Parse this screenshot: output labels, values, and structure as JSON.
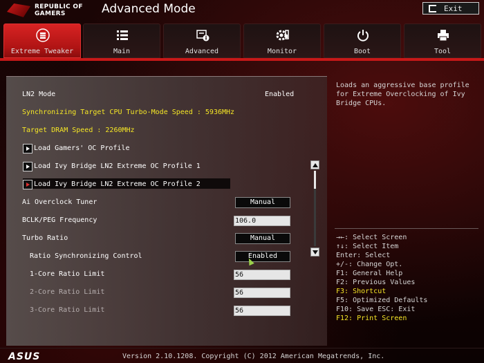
{
  "header": {
    "brand": "REPUBLIC OF GAMERS",
    "title": "Advanced Mode",
    "exit_label": "Exit"
  },
  "tabs": [
    {
      "label": "Extreme Tweaker",
      "icon": "tweaker-icon",
      "active": true
    },
    {
      "label": "Main",
      "icon": "list-icon",
      "active": false
    },
    {
      "label": "Advanced",
      "icon": "advanced-info-icon",
      "active": false
    },
    {
      "label": "Monitor",
      "icon": "monitor-gear-icon",
      "active": false
    },
    {
      "label": "Boot",
      "icon": "power-icon",
      "active": false
    },
    {
      "label": "Tool",
      "icon": "printer-tool-icon",
      "active": false
    }
  ],
  "settings": {
    "ln2_mode": {
      "label": "LN2 Mode",
      "value": "Enabled"
    },
    "sync_cpu_speed": "Synchronizing Target CPU Turbo-Mode Speed : 5936MHz",
    "target_dram": "Target DRAM Speed : 2260MHz",
    "load_gamers": "Load Gamers' OC Profile",
    "load_ivy1": "Load Ivy Bridge LN2 Extreme OC Profile 1",
    "load_ivy2": "Load Ivy Bridge LN2 Extreme OC Profile 2",
    "ai_overclock": {
      "label": "Ai Overclock Tuner",
      "value": "Manual"
    },
    "bclk": {
      "label": "BCLK/PEG Frequency",
      "value": "106.0"
    },
    "turbo_ratio": {
      "label": "Turbo Ratio",
      "value": "Manual"
    },
    "ratio_sync": {
      "label": "Ratio Synchronizing Control",
      "value": "Enabled"
    },
    "core1": {
      "label": "1-Core Ratio Limit",
      "value": "56"
    },
    "core2": {
      "label": "2-Core Ratio Limit",
      "value": "56"
    },
    "core3": {
      "label": "3-Core Ratio Limit",
      "value": "56"
    }
  },
  "help": {
    "description": "Loads an aggressive base profile for Extreme Overclocking of Ivy Bridge CPUs."
  },
  "keys": [
    "→←: Select Screen",
    "↑↓: Select Item",
    "Enter: Select",
    "+/-: Change Opt.",
    "F1: General Help",
    "F2: Previous Values",
    "F3: Shortcut",
    "F5: Optimized Defaults",
    "F10: Save  ESC: Exit",
    "F12: Print Screen"
  ],
  "footer": {
    "brand": "ASUS",
    "version": "Version 2.10.1208. Copyright (C) 2012 American Megatrends, Inc."
  },
  "colors": {
    "accent_red": "#c81818",
    "highlight_yellow": "#f5e626"
  }
}
